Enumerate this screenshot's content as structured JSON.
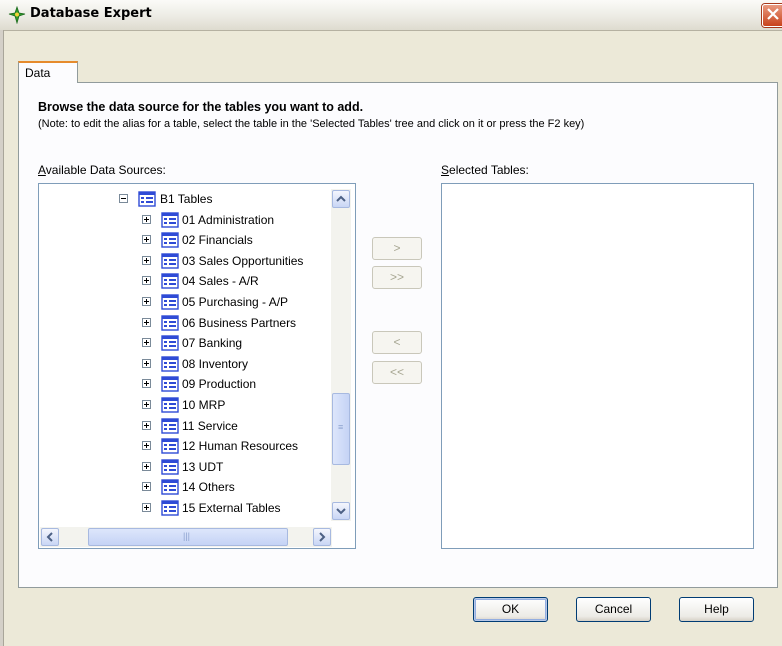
{
  "window": {
    "title": "Database Expert"
  },
  "tabs": [
    {
      "label": "Data"
    }
  ],
  "content": {
    "heading": "Browse the data source for the tables you want to add.",
    "note": "(Note: to edit the alias for a table, select the table in the 'Selected Tables' tree and click on it or press the F2 key)",
    "available_label": {
      "mnemonic": "A",
      "rest": "vailable Data Sources:"
    },
    "selected_label": {
      "mnemonic": "S",
      "rest": "elected Tables:"
    }
  },
  "tree": {
    "root": {
      "label": "B1 Tables",
      "expanded": true
    },
    "items": [
      {
        "label": "01 Administration"
      },
      {
        "label": "02 Financials"
      },
      {
        "label": "03 Sales Opportunities"
      },
      {
        "label": "04 Sales - A/R"
      },
      {
        "label": "05 Purchasing - A/P"
      },
      {
        "label": "06 Business Partners"
      },
      {
        "label": "07 Banking"
      },
      {
        "label": "08 Inventory"
      },
      {
        "label": "09 Production"
      },
      {
        "label": "10 MRP"
      },
      {
        "label": "11 Service"
      },
      {
        "label": "12 Human Resources"
      },
      {
        "label": "13 UDT"
      },
      {
        "label": "14 Others"
      },
      {
        "label": "15 External Tables"
      }
    ]
  },
  "transfer_buttons": {
    "add": ">",
    "add_all": ">>",
    "remove": "<",
    "remove_all": "<<"
  },
  "buttons": {
    "ok": "OK",
    "cancel": "Cancel",
    "help": "Help"
  },
  "colors": {
    "tab_accent": "#e68b2c",
    "icon_blue": "#2f4bd6",
    "close_red": "#c8431c"
  }
}
